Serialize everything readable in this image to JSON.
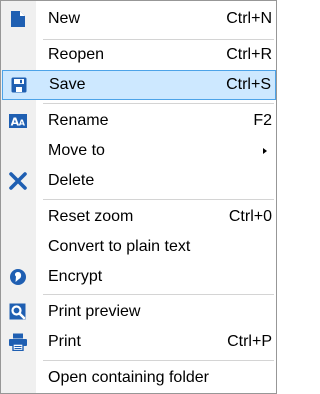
{
  "menu": {
    "items": [
      {
        "label": "New",
        "shortcut": "Ctrl+N",
        "icon": "new-document-icon"
      },
      {
        "label": "Reopen",
        "shortcut": "Ctrl+R",
        "icon": ""
      },
      {
        "label": "Save",
        "shortcut": "Ctrl+S",
        "icon": "floppy-disk-icon"
      },
      {
        "label": "Rename",
        "shortcut": "F2",
        "icon": "rename-icon"
      },
      {
        "label": "Move to",
        "shortcut": "",
        "icon": "",
        "submenu": true
      },
      {
        "label": "Delete",
        "shortcut": "",
        "icon": "delete-x-icon"
      },
      {
        "label": "Reset zoom",
        "shortcut": "Ctrl+0",
        "icon": ""
      },
      {
        "label": "Convert to plain text",
        "shortcut": "",
        "icon": ""
      },
      {
        "label": "Encrypt",
        "shortcut": "",
        "icon": "encrypt-icon"
      },
      {
        "label": "Print preview",
        "shortcut": "",
        "icon": "print-preview-icon"
      },
      {
        "label": "Print",
        "shortcut": "Ctrl+P",
        "icon": "printer-icon"
      },
      {
        "label": "Open containing folder",
        "shortcut": "",
        "icon": ""
      }
    ]
  },
  "colors": {
    "highlight_background": "#cde8ff",
    "highlight_border": "#4da3e8",
    "icon_blue": "#1f5fb2"
  }
}
